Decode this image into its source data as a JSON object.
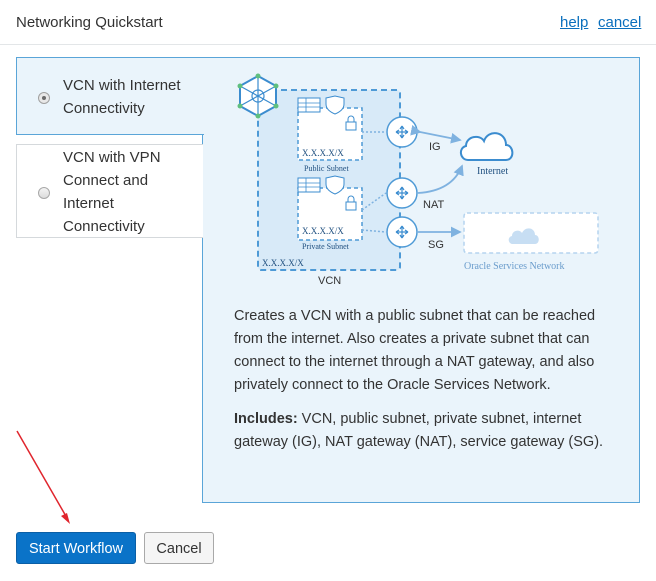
{
  "header": {
    "title": "Networking Quickstart",
    "help_label": "help",
    "cancel_label": "cancel"
  },
  "options": [
    {
      "label": "VCN with Internet Connectivity",
      "selected": true
    },
    {
      "label": "VCN with VPN Connect and Internet Connectivity",
      "selected": false
    }
  ],
  "diagram": {
    "cidr_public": "X.X.X.X/X",
    "public_subnet": "Public Subnet",
    "cidr_private": "X.X.X.X/X",
    "private_subnet": "Private Subnet",
    "cidr_vcn": "X.X.X.X/X",
    "vcn": "VCN",
    "ig": "IG",
    "nat": "NAT",
    "sg": "SG",
    "internet": "Internet",
    "oracle_services": "Oracle Services Network"
  },
  "description": {
    "text": "Creates a VCN with a public subnet that can be reached from the internet. Also creates a private subnet that can connect to the internet through a NAT gateway, and also privately connect to the Oracle Services Network.",
    "includes_label": "Includes:",
    "includes_text": " VCN, public subnet, private subnet, internet gateway (IG), NAT gateway (NAT), service gateway (SG)."
  },
  "footer": {
    "start_label": "Start Workflow",
    "cancel_label": "Cancel"
  },
  "colors": {
    "accent": "#0a73c8",
    "panel_bg": "#eaf4fb",
    "panel_border": "#5aa5d8",
    "link": "#0a6fbd",
    "annotation_arrow": "#e0252d"
  }
}
